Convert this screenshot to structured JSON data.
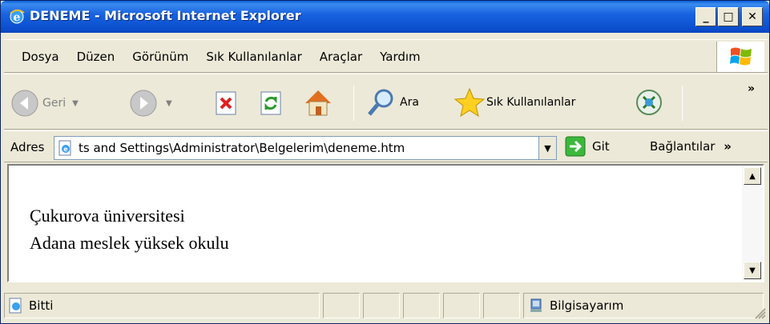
{
  "window": {
    "title": "DENEME - Microsoft Internet Explorer",
    "buttons": {
      "minimize": "_",
      "maximize": "□",
      "close": "✕"
    }
  },
  "menu": {
    "items": [
      {
        "label": "Dosya"
      },
      {
        "label": "Düzen"
      },
      {
        "label": "Görünüm"
      },
      {
        "label": "Sık Kullanılanlar"
      },
      {
        "label": "Araçlar"
      },
      {
        "label": "Yardım"
      }
    ]
  },
  "toolbar": {
    "back_label": "Geri",
    "search_label": "Ara",
    "favorites_label": "Sık Kullanılanlar",
    "overflow": "»"
  },
  "address": {
    "label": "Adres",
    "value": "ts and Settings\\Administrator\\Belgelerim\\deneme.htm",
    "go_label": "Git",
    "links_label": "Bağlantılar",
    "overflow": "»"
  },
  "content": {
    "lines": [
      "Çukurova üniversitesi",
      "Adana meslek yüksek okulu"
    ]
  },
  "status": {
    "text": "Bitti",
    "zone": "Bilgisayarım"
  },
  "colors": {
    "titlebar": "#0b4fcf",
    "chrome": "#ece9d8"
  }
}
